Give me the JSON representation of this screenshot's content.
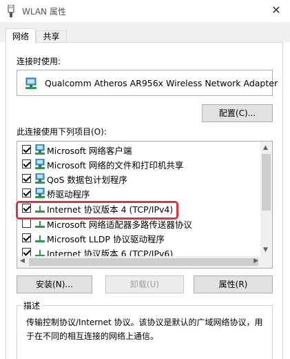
{
  "window": {
    "title": "WLAN 属性",
    "close_glyph": "✕"
  },
  "tabs": [
    {
      "label": "网络",
      "active": true
    },
    {
      "label": "共享",
      "active": false
    }
  ],
  "connect_using_label": "连接时使用:",
  "adapter_name": "Qualcomm Atheros AR956x Wireless Network Adapter",
  "configure_button": "配置(C)...",
  "items_label": "此连接使用下列项目(O):",
  "items": [
    {
      "label": "Microsoft 网络客户端",
      "checked": true,
      "icon": "network-client-icon"
    },
    {
      "label": "Microsoft 网络的文件和打印机共享",
      "checked": true,
      "icon": "network-client-icon"
    },
    {
      "label": "QoS 数据包计划程序",
      "checked": true,
      "icon": "network-client-icon"
    },
    {
      "label": "桥驱动程序",
      "checked": true,
      "icon": "network-client-icon"
    },
    {
      "label": "Internet 协议版本 4 (TCP/IPv4)",
      "checked": true,
      "icon": "protocol-icon"
    },
    {
      "label": "Microsoft 网络适配器多路传送器协议",
      "checked": false,
      "icon": "protocol-icon"
    },
    {
      "label": "Microsoft LLDP 协议驱动程序",
      "checked": true,
      "icon": "protocol-icon"
    },
    {
      "label": "Internet 协议版本 6 (TCP/IPv6)",
      "checked": true,
      "icon": "protocol-icon"
    }
  ],
  "buttons": {
    "install": "安装(N)...",
    "uninstall": "卸载(U)",
    "properties": "属性(R)"
  },
  "description": {
    "legend": "描述",
    "text": "传输控制协议/Internet 协议。该协议是默认的广域网络协议，用于在不同的相互连接的网络上通信。"
  },
  "colors": {
    "highlight": "#e0313d",
    "accent": "#0078d7"
  }
}
